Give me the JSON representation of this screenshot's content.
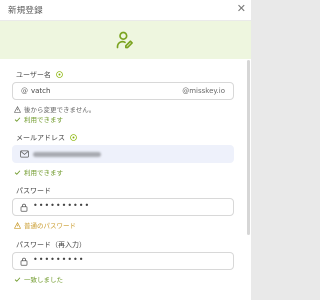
{
  "dialog": {
    "title": "新規登録",
    "close_icon": "close-icon",
    "header_icon": "user-add-icon"
  },
  "username": {
    "label": "ユーザー名",
    "prefix": "@",
    "value": "vatch",
    "suffix": "@misskey.io",
    "warning": "後から変更できません。",
    "status": "利用できます"
  },
  "email": {
    "label": "メールアドレス",
    "status": "利用できます"
  },
  "password": {
    "label": "パスワード",
    "value": "••••••••••",
    "status": "普通のパスワード"
  },
  "password_confirm": {
    "label": "パスワード（再入力）",
    "value": "•••••••••",
    "status": "一致しました"
  },
  "colors": {
    "accent": "#86b300",
    "ok": "#6f9a2a",
    "weak": "#c99a2a",
    "banner": "#eef6df"
  }
}
